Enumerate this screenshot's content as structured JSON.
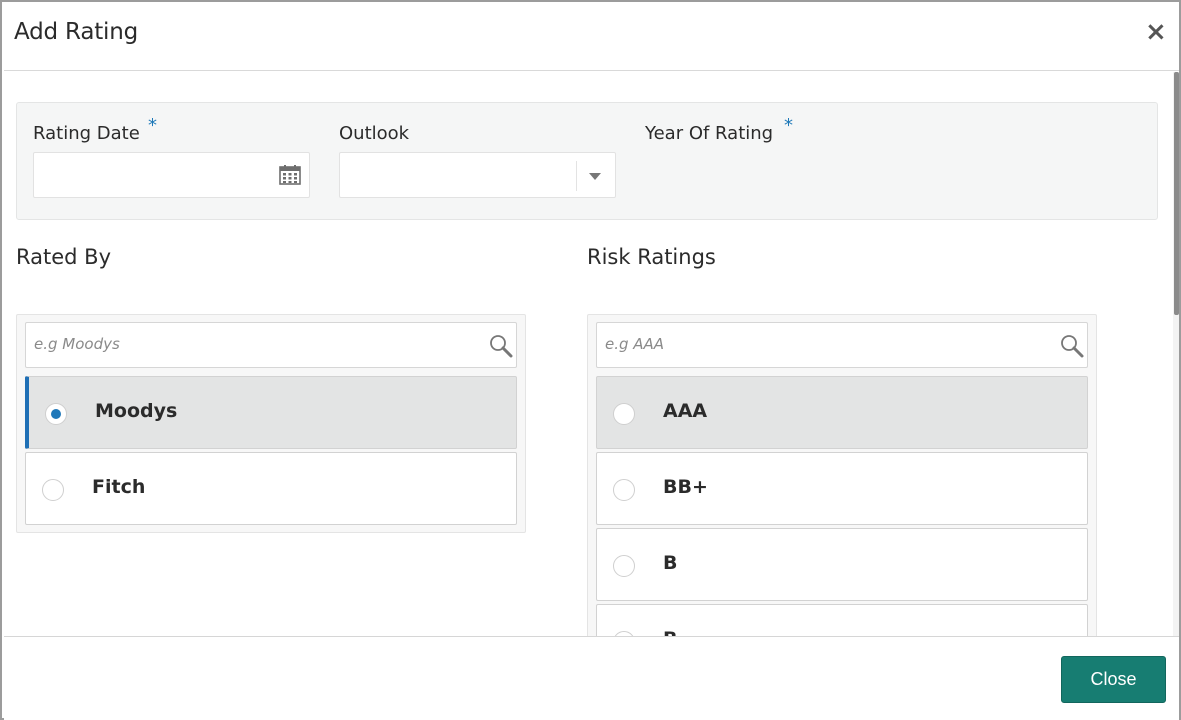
{
  "dialog": {
    "title": "Add Rating",
    "close_icon": "close-icon",
    "footer": {
      "close_label": "Close"
    }
  },
  "form": {
    "rating_date": {
      "label": "Rating Date",
      "required_mark": "*",
      "value": "",
      "icon": "calendar-icon"
    },
    "outlook": {
      "label": "Outlook",
      "value": "",
      "icon": "chevron-down-icon"
    },
    "year_of_rating": {
      "label": "Year Of Rating",
      "required_mark": "*"
    }
  },
  "rated_by": {
    "title": "Rated By",
    "search_placeholder": "e.g Moodys",
    "options": [
      {
        "label": "Moodys",
        "selected": true
      },
      {
        "label": "Fitch",
        "selected": false
      }
    ]
  },
  "risk_ratings": {
    "title": "Risk Ratings",
    "search_placeholder": "e.g AAA",
    "options": [
      {
        "label": "AAA",
        "selected": false
      },
      {
        "label": "BB+",
        "selected": false
      },
      {
        "label": "B",
        "selected": false
      },
      {
        "label": "B",
        "selected": false
      }
    ]
  },
  "colors": {
    "accent": "#1f78b9",
    "primary_button": "#177d72"
  }
}
